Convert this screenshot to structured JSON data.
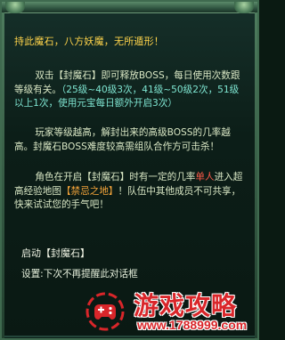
{
  "dialog": {
    "headline": "持此魔石，八方妖魔，无所遁形！",
    "para1": {
      "prefix": "双击【封魔石】即可释放BOSS，每日使用次数跟等级有关。",
      "levels": "（25级~40级3次，41级~50级2次，51级以上1次，使用元宝每日额外开启3次）"
    },
    "para2": "玩家等级越高，解封出来的高级BOSS的几率越高。封魔石BOSS难度较高需组队合作方可击杀！",
    "para3": {
      "prefix": "角色在开启【封魔石】时有一定的几率",
      "solo": "单人",
      "middle": "进入超高经验地图",
      "map": "【禁忌之地】",
      "suffix": "！队伍中其他成员不可共享，快来试试您的手气吧！"
    },
    "activate_label": "启动【封魔石】",
    "setting_label": "设置:下次不再提醒此对话框"
  },
  "watermark": {
    "title": "游戏攻略",
    "url": "www.1788999.com"
  },
  "colors": {
    "headline": "#ffd44a",
    "body_text": "#d9e7c4",
    "level_highlight": "#7fe6d2",
    "solo_highlight": "#ff5a4a",
    "map_highlight": "#f4a43a",
    "watermark_red": "#d9262a"
  }
}
